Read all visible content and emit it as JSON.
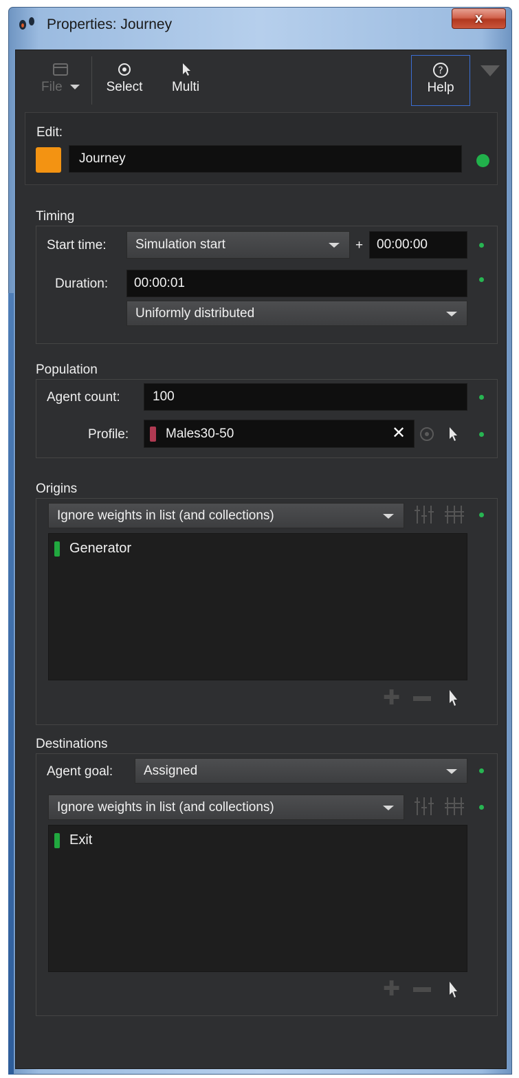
{
  "window": {
    "title": "Properties: Journey",
    "close_label": "x"
  },
  "toolbar": {
    "file_label": "File",
    "select_label": "Select",
    "multi_label": "Multi",
    "help_label": "Help"
  },
  "edit": {
    "label": "Edit:",
    "name_value": "Journey",
    "color": "#f39312"
  },
  "timing": {
    "title": "Timing",
    "start_time_label": "Start time:",
    "start_time_option": "Simulation start",
    "plus": "+",
    "start_offset": "00:00:00",
    "duration_label": "Duration:",
    "duration_value": "00:00:01",
    "distribution_option": "Uniformly distributed"
  },
  "population": {
    "title": "Population",
    "agent_count_label": "Agent count:",
    "agent_count_value": "100",
    "profile_label": "Profile:",
    "profile_value": "Males30-50",
    "profile_color": "#b03a52"
  },
  "origins": {
    "title": "Origins",
    "weights_option": "Ignore weights in list (and collections)",
    "items": [
      {
        "label": "Generator",
        "color": "#21a83f"
      }
    ]
  },
  "destinations": {
    "title": "Destinations",
    "agent_goal_label": "Agent goal:",
    "agent_goal_option": "Assigned",
    "weights_option": "Ignore weights in list (and collections)",
    "items": [
      {
        "label": "Exit",
        "color": "#21a83f"
      }
    ]
  },
  "colors": {
    "status_green": "#21b14b",
    "accent_orange": "#f39312"
  }
}
